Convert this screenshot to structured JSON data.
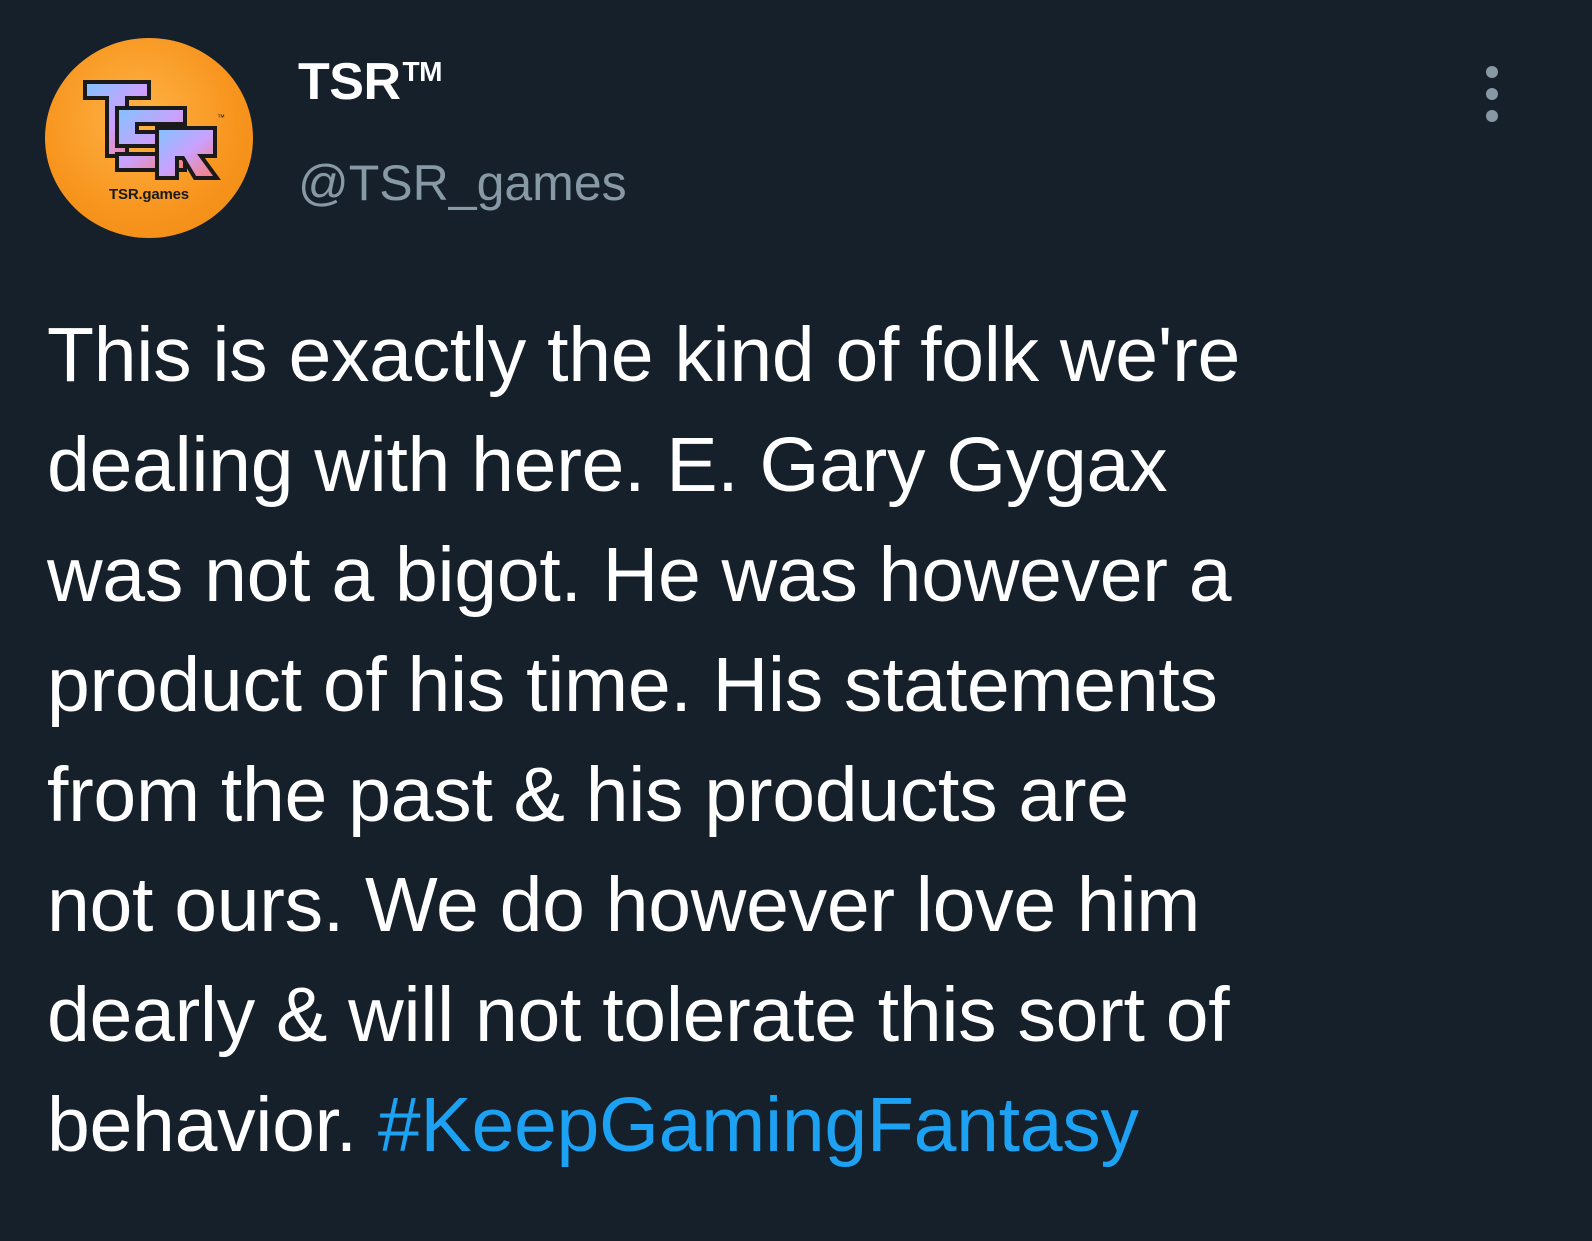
{
  "account": {
    "display_name": "TSR",
    "trademark": "TM",
    "handle": "@TSR_games",
    "avatar_caption": "TSR.games",
    "avatar_logo_letters": "TSR",
    "avatar_trademark": "™"
  },
  "tweet": {
    "lines": [
      "This is exactly the kind of folk we're",
      "dealing with here. E. Gary Gygax",
      "was not a bigot. He was however a",
      "product of his time. His statements",
      "from the past & his products are",
      "not ours. We do however love him",
      "dearly & will not tolerate this sort of"
    ],
    "last_line_text": "behavior. ",
    "hashtag": "#KeepGamingFantasy"
  },
  "icons": {
    "more": "more-vertical-icon"
  },
  "colors": {
    "background": "#15202b",
    "text": "#ffffff",
    "secondary_text": "#8899a6",
    "link": "#1da1f2",
    "avatar_bg": "#f7941d"
  }
}
